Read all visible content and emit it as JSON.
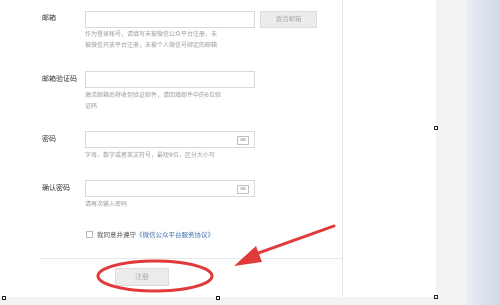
{
  "fields": {
    "email": {
      "label": "邮箱",
      "hint_line1": "作为登录帐号，请填写未被微信公众平台注册，未",
      "hint_line2": "被微信开放平台注册，未被个人微信号绑定的邮箱",
      "activate_label": "激活邮箱"
    },
    "code": {
      "label": "邮箱验证码",
      "hint_line1": "激活邮箱后将收到验证邮件，请回填邮件中的6位验",
      "hint_line2": "证码"
    },
    "password": {
      "label": "密码",
      "hint": "字母、数字或者英文符号，最短8位，区分大小写"
    },
    "confirm": {
      "label": "确认密码",
      "hint": "请再次输入密码"
    },
    "keyboard_icon": "keyboard-icon"
  },
  "agreement": {
    "prefix": "我同意并遵守",
    "link": "《微信公众平台服务协议》"
  },
  "register_label": "注册",
  "annotation_color": "#e03a3a"
}
